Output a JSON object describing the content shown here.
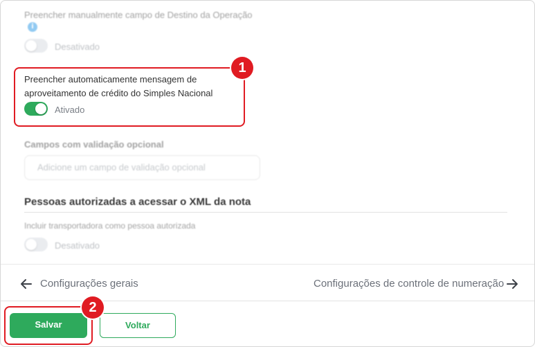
{
  "section_destino": {
    "label": "Preencher manualmente campo de Destino da Operação",
    "info_icon": "i",
    "state": "Desativado"
  },
  "section_simples": {
    "label_line1": "Preencher automaticamente mensagem de",
    "label_line2": "aproveitamento de crédito do Simples Nacional",
    "state": "Ativado"
  },
  "campos": {
    "title": "Campos com validação opcional",
    "placeholder": "Adicione um campo de validação opcional"
  },
  "pessoas": {
    "heading": "Pessoas autorizadas a acessar o XML da nota",
    "label": "Incluir transportadora como pessoa autorizada",
    "state": "Desativado"
  },
  "navigation": {
    "prev": "Configurações gerais",
    "next": "Configurações de controle de numeração"
  },
  "actions": {
    "save": "Salvar",
    "back": "Voltar"
  },
  "badges": {
    "first": "1",
    "second": "2"
  },
  "colors": {
    "accent": "#2eaa5c",
    "highlight": "#e01b22",
    "info": "#3aa0e8"
  }
}
